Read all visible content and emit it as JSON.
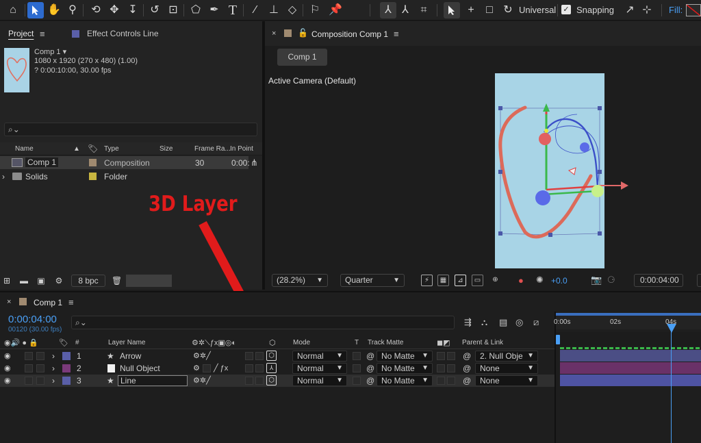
{
  "toolbar": {
    "axis_mode": "Universal",
    "snapping_label": "Snapping",
    "snapping_checked": "✓",
    "fill_label": "Fill:"
  },
  "project_panel": {
    "tabs": [
      "Project",
      "Effect Controls Line"
    ],
    "comp_name": "Comp 1",
    "comp_dims": "1080 x 1920  (270 x 480) (1.00)",
    "comp_duration": "? 0:00:10:00, 30.00 fps",
    "columns": [
      "Name",
      "Type",
      "Size",
      "Frame Ra...",
      "In Point"
    ],
    "items": [
      {
        "name": "Comp 1",
        "type": "Composition",
        "frame_rate": "30",
        "in_point": "0:00:"
      },
      {
        "name": "Solids",
        "type": "Folder",
        "frame_rate": "",
        "in_point": ""
      }
    ],
    "bpc": "8 bpc"
  },
  "comp_panel": {
    "tab_title": "Composition Comp 1",
    "comp_button": "Comp 1",
    "camera": "Active Camera (Default)",
    "zoom": "(28.2%)",
    "resolution": "Quarter",
    "exposure": "+0.0",
    "timecode": "0:00:04:00"
  },
  "annotation": "3D Layer",
  "timeline": {
    "tab_title": "Comp 1",
    "timecode": "0:00:04:00",
    "frame_info": "00120 (30.00 fps)",
    "headers": {
      "num": "#",
      "layer_name": "Layer Name",
      "mode": "Mode",
      "t": "T",
      "track_matte": "Track Matte",
      "parent": "Parent & Link"
    },
    "ruler": [
      "0:00s",
      "02s",
      "04s"
    ],
    "layers": [
      {
        "num": "1",
        "name": "Arrow",
        "mode": "Normal",
        "matte": "No Matte",
        "parent": "2. Null Obje",
        "color": "#5a5fa8"
      },
      {
        "num": "2",
        "name": "Null Object",
        "mode": "Normal",
        "matte": "No Matte",
        "parent": "None",
        "color": "#7a3a7a"
      },
      {
        "num": "3",
        "name": "Line",
        "mode": "Normal",
        "matte": "No Matte",
        "parent": "None",
        "color": "#5a5fa8"
      }
    ]
  },
  "colors": {
    "accent_blue": "#2d6bcf",
    "timecode_blue": "#4a9ff5",
    "annotation_red": "#e11b1b",
    "viewer_bg": "#a8d4e6"
  }
}
